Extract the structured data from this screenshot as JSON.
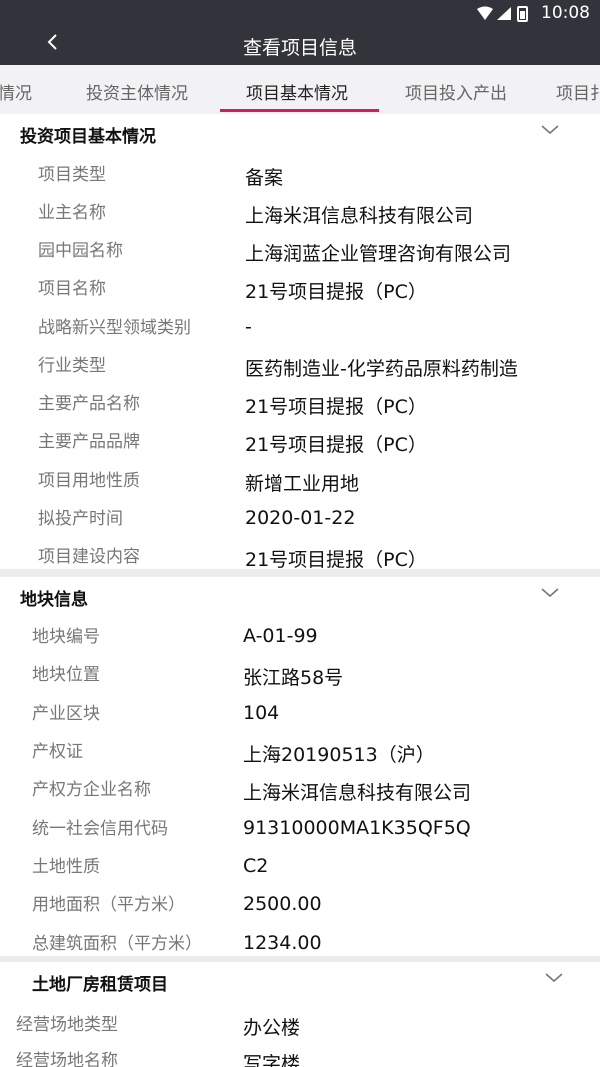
{
  "status": {
    "time": "10:08"
  },
  "header": {
    "title": "查看项目信息",
    "back_icon": "chevron-left-icon"
  },
  "tabs": [
    "情况",
    "投资主体情况",
    "项目基本情况",
    "项目投入产出",
    "项目扌"
  ],
  "active_tab": "项目基本情况",
  "sections": {
    "basic": {
      "title": "投资项目基本情况",
      "rows": [
        {
          "label": "项目类型",
          "value": "备案"
        },
        {
          "label": "业主名称",
          "value": "上海米洱信息科技有限公司"
        },
        {
          "label": "园中园名称",
          "value": "上海润蓝企业管理咨询有限公司"
        },
        {
          "label": "项目名称",
          "value": "21号项目提报（PC）"
        },
        {
          "label": "战略新兴型领域类别",
          "value": "-"
        },
        {
          "label": "行业类型",
          "value": "医药制造业-化学药品原料药制造"
        },
        {
          "label": "主要产品名称",
          "value": "21号项目提报（PC）"
        },
        {
          "label": "主要产品品牌",
          "value": "21号项目提报（PC）"
        },
        {
          "label": "项目用地性质",
          "value": "新增工业用地"
        },
        {
          "label": "拟投产时间",
          "value": "2020-01-22"
        },
        {
          "label": "项目建设内容",
          "value": "21号项目提报（PC）"
        }
      ]
    },
    "land": {
      "title": "地块信息",
      "rows": [
        {
          "label": "地块编号",
          "value": "A-01-99"
        },
        {
          "label": "地块位置",
          "value": "张江路58号"
        },
        {
          "label": "产业区块",
          "value": "104"
        },
        {
          "label": "产权证",
          "value": "上海20190513（沪）"
        },
        {
          "label": "产权方企业名称",
          "value": "上海米洱信息科技有限公司"
        },
        {
          "label": "统一社会信用代码",
          "value": "91310000MA1K35QF5Q"
        },
        {
          "label": "土地性质",
          "value": "C2"
        },
        {
          "label": "用地面积（平方米）",
          "value": "2500.00"
        },
        {
          "label": "总建筑面积（平方米）",
          "value": "1234.00"
        }
      ]
    },
    "lease": {
      "title": "土地厂房租赁项目",
      "rows": [
        {
          "label": "经营场地类型",
          "value": "办公楼"
        },
        {
          "label": "经营场地名称",
          "value": "写字楼"
        }
      ]
    }
  },
  "colors": {
    "header_bg": "#33333b",
    "accent": "#d81b60",
    "tab_bg": "#f2f2f4"
  }
}
